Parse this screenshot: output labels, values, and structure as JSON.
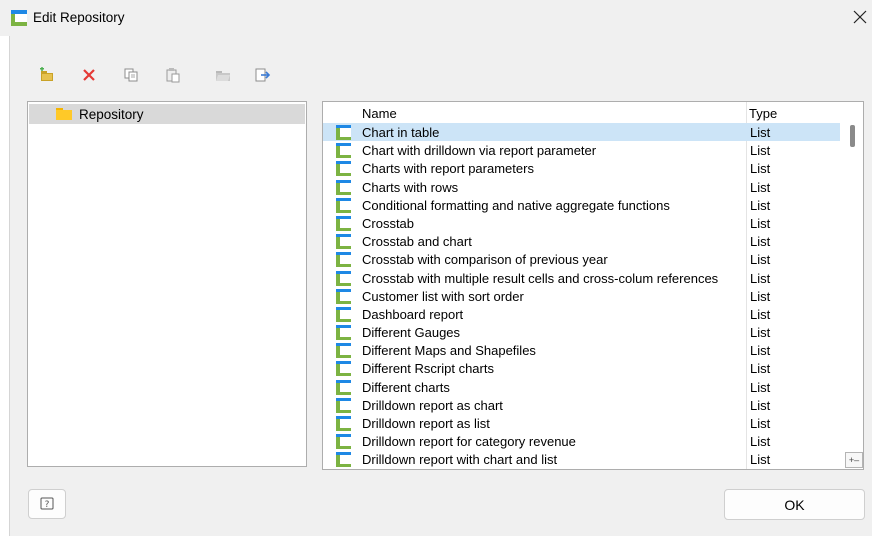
{
  "window": {
    "title": "Edit Repository",
    "close_glyph": "✕"
  },
  "toolbar": [
    {
      "name": "new-folder-icon"
    },
    {
      "name": "delete-icon"
    },
    {
      "name": "copy-icon"
    },
    {
      "name": "paste-icon"
    },
    {
      "name": "open-folder-icon"
    },
    {
      "name": "export-icon"
    }
  ],
  "tree": {
    "root_label": "Repository"
  },
  "list": {
    "columns": {
      "name": "Name",
      "type": "Type"
    },
    "rows": [
      {
        "name": "Chart in table",
        "type": "List",
        "selected": true
      },
      {
        "name": "Chart with drilldown via report parameter",
        "type": "List"
      },
      {
        "name": "Charts with report parameters",
        "type": "List"
      },
      {
        "name": "Charts with rows",
        "type": "List"
      },
      {
        "name": "Conditional formatting and native aggregate functions",
        "type": "List"
      },
      {
        "name": "Crosstab",
        "type": "List"
      },
      {
        "name": "Crosstab and chart",
        "type": "List"
      },
      {
        "name": "Crosstab with comparison of previous year",
        "type": "List"
      },
      {
        "name": "Crosstab with multiple result cells and cross-colum references",
        "type": "List"
      },
      {
        "name": "Customer list with sort order",
        "type": "List"
      },
      {
        "name": "Dashboard report",
        "type": "List"
      },
      {
        "name": "Different Gauges",
        "type": "List"
      },
      {
        "name": "Different Maps and Shapefiles",
        "type": "List"
      },
      {
        "name": "Different Rscript charts",
        "type": "List"
      },
      {
        "name": "Different charts",
        "type": "List"
      },
      {
        "name": "Drilldown report as chart",
        "type": "List"
      },
      {
        "name": "Drilldown report as list",
        "type": "List"
      },
      {
        "name": "Drilldown report for category revenue",
        "type": "List"
      },
      {
        "name": "Drilldown report with chart and list",
        "type": "List"
      }
    ],
    "corner_glyph": "+–"
  },
  "buttons": {
    "ok_label": "OK"
  },
  "colors": {
    "accent_blue": "#1e88e5",
    "accent_green": "#7cb342",
    "delete_red": "#e53935",
    "selection": "#cce4f7"
  }
}
